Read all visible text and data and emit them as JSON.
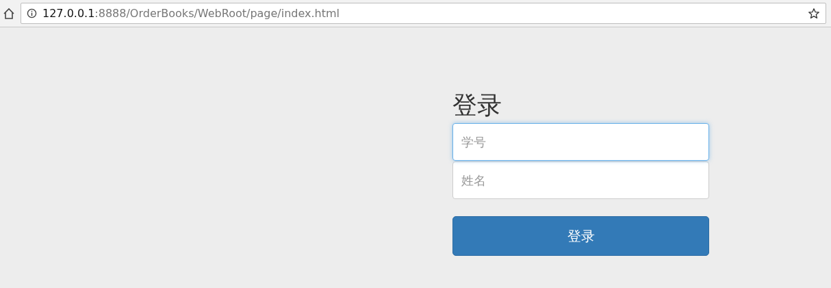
{
  "address_bar": {
    "host": "127.0.0.1",
    "path": ":8888/OrderBooks/WebRoot/page/index.html"
  },
  "login": {
    "title": "登录",
    "fields": [
      {
        "placeholder": "学号",
        "focused": true
      },
      {
        "placeholder": "姓名",
        "focused": false
      }
    ],
    "button": "登录"
  }
}
